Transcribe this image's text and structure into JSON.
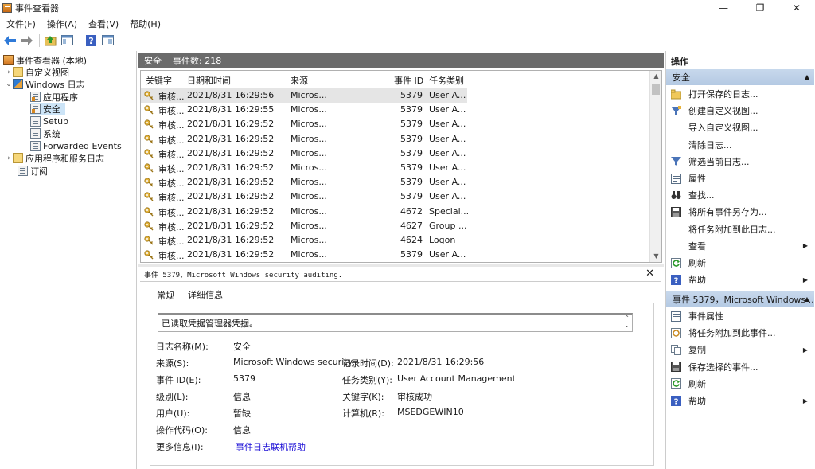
{
  "window": {
    "title": "事件查看器",
    "controls": [
      "—",
      "❐",
      "✕"
    ]
  },
  "menu": [
    "文件(F)",
    "操作(A)",
    "查看(V)",
    "帮助(H)"
  ],
  "toolbar": [
    "back-icon",
    "forward-icon",
    "folder-up-icon",
    "console-view-icon",
    "help-icon",
    "properties-view-icon"
  ],
  "tree": {
    "root": "事件查看器 (本地)",
    "custom_views": "自定义视图",
    "windows_logs": "Windows 日志",
    "application": "应用程序",
    "security": "安全",
    "setup": "Setup",
    "system": "系统",
    "forwarded": "Forwarded Events",
    "app_services": "应用程序和服务日志",
    "subscriptions": "订阅"
  },
  "list": {
    "log_name": "安全",
    "count_label": "事件数: 218",
    "columns": [
      "关键字",
      "日期和时间",
      "来源",
      "事件 ID",
      "任务类别"
    ],
    "rows": [
      {
        "keyword": "审核...",
        "datetime": "2021/8/31 16:29:56",
        "source": "Micros...",
        "event_id": "5379",
        "category": "User A..."
      },
      {
        "keyword": "审核...",
        "datetime": "2021/8/31 16:29:55",
        "source": "Micros...",
        "event_id": "5379",
        "category": "User A..."
      },
      {
        "keyword": "审核...",
        "datetime": "2021/8/31 16:29:52",
        "source": "Micros...",
        "event_id": "5379",
        "category": "User A..."
      },
      {
        "keyword": "审核...",
        "datetime": "2021/8/31 16:29:52",
        "source": "Micros...",
        "event_id": "5379",
        "category": "User A..."
      },
      {
        "keyword": "审核...",
        "datetime": "2021/8/31 16:29:52",
        "source": "Micros...",
        "event_id": "5379",
        "category": "User A..."
      },
      {
        "keyword": "审核...",
        "datetime": "2021/8/31 16:29:52",
        "source": "Micros...",
        "event_id": "5379",
        "category": "User A..."
      },
      {
        "keyword": "审核...",
        "datetime": "2021/8/31 16:29:52",
        "source": "Micros...",
        "event_id": "5379",
        "category": "User A..."
      },
      {
        "keyword": "审核...",
        "datetime": "2021/8/31 16:29:52",
        "source": "Micros...",
        "event_id": "5379",
        "category": "User A..."
      },
      {
        "keyword": "审核...",
        "datetime": "2021/8/31 16:29:52",
        "source": "Micros...",
        "event_id": "4672",
        "category": "Special..."
      },
      {
        "keyword": "审核...",
        "datetime": "2021/8/31 16:29:52",
        "source": "Micros...",
        "event_id": "4627",
        "category": "Group ..."
      },
      {
        "keyword": "审核...",
        "datetime": "2021/8/31 16:29:52",
        "source": "Micros...",
        "event_id": "4624",
        "category": "Logon"
      },
      {
        "keyword": "审核...",
        "datetime": "2021/8/31 16:29:52",
        "source": "Micros...",
        "event_id": "5379",
        "category": "User A..."
      }
    ]
  },
  "detail": {
    "title": "事件 5379，Microsoft Windows security auditing.",
    "close": "✕",
    "tabs": [
      "常规",
      "详细信息"
    ],
    "description": "已读取凭据管理器凭据。",
    "labels": {
      "log_name": "日志名称(M):",
      "source": "来源(S):",
      "event_id": "事件 ID(E):",
      "level": "级别(L):",
      "user": "用户(U):",
      "opcode": "操作代码(O):",
      "more_info": "更多信息(I):",
      "logged": "记录时间(D):",
      "task_category": "任务类别(Y):",
      "keywords": "关键字(K):",
      "computer": "计算机(R):"
    },
    "values": {
      "log_name": "安全",
      "source": "Microsoft Windows security",
      "event_id": "5379",
      "level": "信息",
      "user": "暂缺",
      "opcode": "信息",
      "more_info": "事件日志联机帮助",
      "logged": "2021/8/31 16:29:56",
      "task_category": "User Account Management",
      "keywords": "审核成功",
      "computer": "MSEDGEWIN10"
    }
  },
  "actions": {
    "title": "操作",
    "section1": "安全",
    "items1": [
      {
        "label": "打开保存的日志...",
        "icon": "open-folder-icon"
      },
      {
        "label": "创建自定义视图...",
        "icon": "filter-create-icon"
      },
      {
        "label": "导入自定义视图...",
        "icon": ""
      },
      {
        "label": "清除日志...",
        "icon": ""
      },
      {
        "label": "筛选当前日志...",
        "icon": "filter-icon"
      },
      {
        "label": "属性",
        "icon": "properties-icon"
      },
      {
        "label": "查找...",
        "icon": "binoculars-icon"
      },
      {
        "label": "将所有事件另存为...",
        "icon": "save-icon"
      },
      {
        "label": "将任务附加到此日志...",
        "icon": ""
      },
      {
        "label": "查看",
        "icon": "",
        "submenu": true
      },
      {
        "label": "刷新",
        "icon": "refresh-icon"
      },
      {
        "label": "帮助",
        "icon": "help-icon",
        "submenu": true
      }
    ],
    "section2": "事件 5379，Microsoft Windows ...",
    "items2": [
      {
        "label": "事件属性",
        "icon": "event-properties-icon"
      },
      {
        "label": "将任务附加到此事件...",
        "icon": "task-icon"
      },
      {
        "label": "复制",
        "icon": "copy-icon",
        "submenu": true
      },
      {
        "label": "保存选择的事件...",
        "icon": "save-icon"
      },
      {
        "label": "刷新",
        "icon": "refresh-icon"
      },
      {
        "label": "帮助",
        "icon": "help-icon",
        "submenu": true
      }
    ]
  }
}
